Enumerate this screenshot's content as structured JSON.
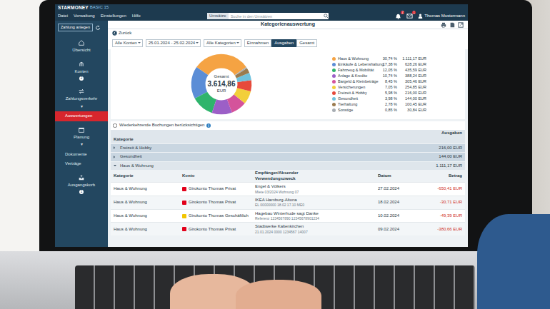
{
  "app": {
    "logo": "STARMONEY",
    "edition": "BASIC 15",
    "user": "Thomas Mustermann",
    "badges": [
      "2",
      "1"
    ]
  },
  "menu": [
    "Datei",
    "Verwaltung",
    "Einstellungen",
    "Hilfe"
  ],
  "search": {
    "scope": "Umsätze",
    "placeholder": "Suche in den Umsätzen"
  },
  "sidebar": {
    "create_button": "Zahlung anlegen",
    "items": [
      {
        "label": "Übersicht",
        "kind": "main",
        "selected": false,
        "badge": "",
        "arrow": ""
      },
      {
        "label": "Konten",
        "kind": "main",
        "selected": false,
        "badge": "2",
        "arrow": ""
      },
      {
        "label": "Zahlungsverkehr",
        "kind": "main",
        "selected": false,
        "badge": "",
        "arrow": "▾"
      },
      {
        "label": "Auswertungen",
        "kind": "sub",
        "selected": true,
        "badge": "",
        "arrow": ""
      },
      {
        "label": "Planung",
        "kind": "main",
        "selected": false,
        "badge": "",
        "arrow": "▾"
      },
      {
        "label": "Dokumente",
        "kind": "sub",
        "selected": false,
        "badge": "",
        "arrow": ""
      },
      {
        "label": "Verträge",
        "kind": "sub",
        "selected": false,
        "badge": "",
        "arrow": ""
      },
      {
        "label": "Ausgangskorb",
        "kind": "main",
        "selected": false,
        "badge": "1",
        "arrow": ""
      }
    ]
  },
  "page": {
    "title": "Kategorienauswertung",
    "back": "Zurück",
    "filters": [
      "Alle Konten",
      "25.01.2024 - 25.02.2024",
      "Alle Kategorien"
    ],
    "modes": [
      {
        "label": "Einnahmen",
        "selected": false
      },
      {
        "label": "Ausgaben",
        "selected": true
      },
      {
        "label": "Gesamt",
        "selected": false
      }
    ]
  },
  "chart": {
    "center_label": "Gesamt",
    "center_value": "3.614,86",
    "center_unit": "EUR",
    "series": [
      {
        "label": "Haus & Wohnung",
        "percent": "30,74 %",
        "amount": "1.111,17 EUR",
        "value": 1111.17,
        "color": "#f5a343"
      },
      {
        "label": "Einkäufe & Lebenshaltung",
        "percent": "17,38 %",
        "amount": "628,26 EUR",
        "value": 628.26,
        "color": "#5b8dd6"
      },
      {
        "label": "Fahrzeug & Mobilität",
        "percent": "12,05 %",
        "amount": "435,59 EUR",
        "value": 435.59,
        "color": "#2fb46c"
      },
      {
        "label": "Anlage & Kredite",
        "percent": "10,74 %",
        "amount": "388,24 EUR",
        "value": 388.24,
        "color": "#9c5fc7"
      },
      {
        "label": "Bargeld & Kleinbeträge",
        "percent": "8,45 %",
        "amount": "305,46 EUR",
        "value": 305.46,
        "color": "#d4539b"
      },
      {
        "label": "Versicherungen",
        "percent": "7,05 %",
        "amount": "254,85 EUR",
        "value": 254.85,
        "color": "#f2cf3a"
      },
      {
        "label": "Freizeit & Hobby",
        "percent": "5,98 %",
        "amount": "216,00 EUR",
        "value": 216.0,
        "color": "#e64a3b"
      },
      {
        "label": "Gesundheit",
        "percent": "3,98 %",
        "amount": "144,00 EUR",
        "value": 144.0,
        "color": "#6fc2dd"
      },
      {
        "label": "Tierhaltung",
        "percent": "2,78 %",
        "amount": "100,45 EUR",
        "value": 100.45,
        "color": "#9a7b4f"
      },
      {
        "label": "Sonstige",
        "percent": "0,85 %",
        "amount": "30,84 EUR",
        "value": 30.84,
        "color": "#a7adb3"
      }
    ]
  },
  "table": {
    "recurring": {
      "label": "Wiederkehrende Buchungen berücksichtigen",
      "checked": false
    },
    "amount_header": "Ausgaben",
    "category_header": "Kategorie",
    "groups": [
      {
        "label": "Freizeit & Hobby",
        "amount": "216,00 EUR",
        "expanded": false
      },
      {
        "label": "Gesundheit",
        "amount": "144,00 EUR",
        "expanded": false
      },
      {
        "label": "Haus & Wohnung",
        "amount": "1.111,17 EUR",
        "expanded": true
      }
    ],
    "columns": [
      {
        "label": "Kategorie",
        "sub": ""
      },
      {
        "label": "Konto",
        "sub": ""
      },
      {
        "label": "Empfänger/Absender",
        "sub": "Verwendungszweck"
      },
      {
        "label": "Datum",
        "sub": ""
      },
      {
        "label": "Betrag",
        "sub": ""
      }
    ],
    "rows": [
      {
        "category": "Haus & Wohnung",
        "account": "Girokonto Thomas Privat",
        "bank_color": "#e2001a",
        "payee": "Engel & Völkers",
        "purpose": "Miete 03/2024 Wohnung 07",
        "date": "27.02.2024",
        "amount": "-650,41 EUR"
      },
      {
        "category": "Haus & Wohnung",
        "account": "Girokonto Thomas Privat",
        "bank_color": "#e2001a",
        "payee": "IKEA Hamburg-Altona",
        "purpose": "EL 00000000 18.02 17.10 ME0",
        "date": "18.02.2024",
        "amount": "-30,71 EUR"
      },
      {
        "category": "Haus & Wohnung",
        "account": "Girokonto Thomas Geschäftlich",
        "bank_color": "#f2c500",
        "payee": "Hagebau Winterhude sagt Danke",
        "purpose": "Referenz 1234567890 12345678901234",
        "date": "10.02.2024",
        "amount": "-49,39 EUR"
      },
      {
        "category": "Haus & Wohnung",
        "account": "Girokonto Thomas Privat",
        "bank_color": "#e2001a",
        "payee": "Stadtwerke Kaltenkirchen",
        "purpose": "21.01.2024 0000 1234567 14007",
        "date": "09.02.2024",
        "amount": "-380,66 EUR"
      }
    ]
  }
}
